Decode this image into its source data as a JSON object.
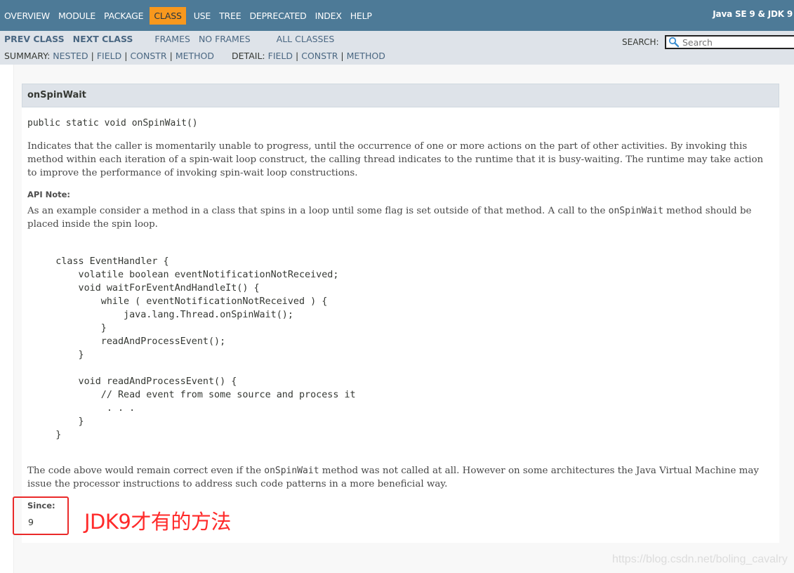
{
  "topnav": {
    "items": [
      {
        "label": "OVERVIEW",
        "active": false
      },
      {
        "label": "MODULE",
        "active": false
      },
      {
        "label": "PACKAGE",
        "active": false
      },
      {
        "label": "CLASS",
        "active": true
      },
      {
        "label": "USE",
        "active": false
      },
      {
        "label": "TREE",
        "active": false
      },
      {
        "label": "DEPRECATED",
        "active": false
      },
      {
        "label": "INDEX",
        "active": false
      },
      {
        "label": "HELP",
        "active": false
      }
    ],
    "about": "Java SE 9 & JDK 9",
    "colors": {
      "bar": "#4d7a97",
      "active": "#f8981d"
    }
  },
  "subnav": {
    "prev_class": "PREV CLASS",
    "next_class": "NEXT CLASS",
    "frames": "FRAMES",
    "no_frames": "NO FRAMES",
    "all_classes": "ALL CLASSES",
    "summary_label": "SUMMARY:",
    "summary_links": [
      "NESTED",
      "FIELD",
      "CONSTR",
      "METHOD"
    ],
    "detail_label": "DETAIL:",
    "detail_links": [
      "FIELD",
      "CONSTR",
      "METHOD"
    ],
    "search_label": "SEARCH:",
    "search_placeholder": "Search",
    "search_value": ""
  },
  "method": {
    "name": "onSpinWait",
    "signature": "public static void onSpinWait()",
    "description": "Indicates that the caller is momentarily unable to progress, until the occurrence of one or more actions on the part of other activities. By invoking this method within each iteration of a spin-wait loop construct, the calling thread indicates to the runtime that it is busy-waiting. The runtime may take action to improve the performance of invoking spin-wait loop constructions.",
    "api_note_label": "API Note:",
    "api_note_before": "As an example consider a method in a class that spins in a loop until some flag is set outside of that method. A call to the ",
    "api_note_code": "onSpinWait",
    "api_note_after": " method should be placed inside the spin loop.",
    "code_example": "     class EventHandler {\n         volatile boolean eventNotificationNotReceived;\n         void waitForEventAndHandleIt() {\n             while ( eventNotificationNotReceived ) {\n                 java.lang.Thread.onSpinWait();\n             }\n             readAndProcessEvent();\n         }\n\n         void readAndProcessEvent() {\n             // Read event from some source and process it\n              . . .\n         }\n     }",
    "closing_before": "The code above would remain correct even if the ",
    "closing_code": "onSpinWait",
    "closing_after": " method was not called at all. However on some architectures the Java Virtual Machine may issue the processor instructions to address such code patterns in a more beneficial way.",
    "since_label": "Since:",
    "since_value": "9"
  },
  "annotation": {
    "text": "JDK9才有的方法",
    "color": "#ff2a2a"
  },
  "watermark": "https://blog.csdn.net/boling_cavalry"
}
